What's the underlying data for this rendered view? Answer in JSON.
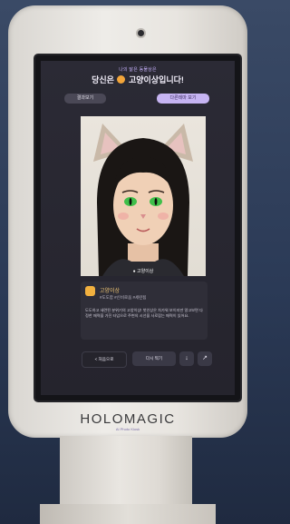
{
  "app": {
    "sup_text": "나의 닮은 동물상은",
    "headline_pre": "당신은",
    "headline_post": "고양이상입니다!",
    "tabs": [
      "결과보기",
      "다른테마 보기"
    ]
  },
  "photo": {
    "caption": "● 고양이상"
  },
  "result_card": {
    "title": "고양이상",
    "tagline": "#도도함  #신비로움  #세련됨",
    "description": "도도하고 세련된 분위기의 고양이상! 첫인상은 차가워 보이지만 알고보면 다정한 매력을 가진 타입으로 주변의 시선을 사로잡는 매력이 있어요."
  },
  "buttons": {
    "back": "< 처음으로",
    "retake": "다시 찍기",
    "icon1": "↓",
    "icon2": "↗"
  },
  "brand": {
    "logo": "HOLOMAGIC",
    "sub": "AI Photo Kiosk"
  },
  "colors": {
    "accent": "#c6b4f2",
    "emoji": "#f2a53a",
    "eye": "#3fbf4a"
  }
}
